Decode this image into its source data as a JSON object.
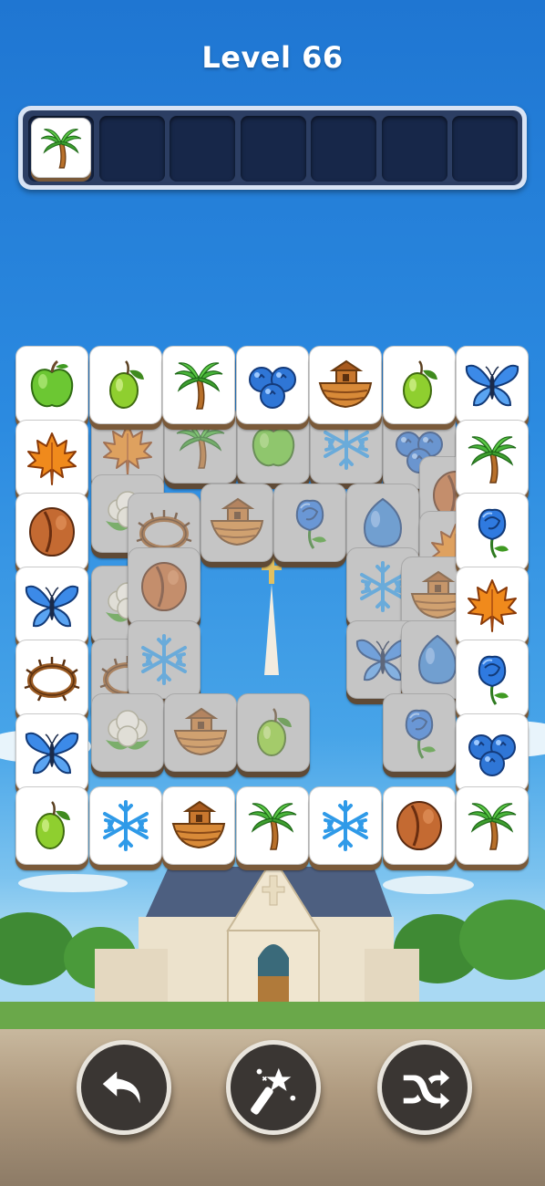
{
  "level_title": "Level 66",
  "tray": {
    "slot_count": 7,
    "filled": [
      "palm-tree"
    ]
  },
  "board": {
    "top_row": [
      "apple",
      "olive",
      "palm-tree",
      "blueberries",
      "ark",
      "olive",
      "butterfly"
    ],
    "left_column": [
      "maple-leaf",
      "coffee-bean",
      "butterfly",
      "thorn-crown",
      "butterfly"
    ],
    "right_column": [
      "palm-tree",
      "blue-rose",
      "maple-leaf",
      "blue-rose",
      "blueberries"
    ],
    "bottom_row": [
      "olive",
      "snowflake",
      "ark",
      "palm-tree",
      "snowflake",
      "coffee-bean",
      "palm-tree"
    ],
    "inner_dim": [
      "maple-leaf",
      "palm-tree",
      "apple",
      "snowflake",
      "blueberries",
      "coffee-bean",
      "cauliflower",
      "thorn-crown",
      "ark",
      "blue-rose",
      "egg",
      "maple-leaf",
      "cauliflower",
      "coffee-bean",
      "snowflake",
      "ark",
      "thorn-crown",
      "snowflake",
      "butterfly",
      "egg",
      "cauliflower",
      "ark",
      "olive",
      "blue-rose"
    ]
  },
  "actions": [
    {
      "name": "undo",
      "icon": "undo-icon"
    },
    {
      "name": "magic-wand",
      "icon": "magic-wand-icon"
    },
    {
      "name": "shuffle",
      "icon": "shuffle-icon"
    }
  ],
  "colors": {
    "sky_top": "#1f76d2",
    "tile_face": "#ffffff",
    "tile_edge": "#7a5a3a",
    "tray_border": "#d8e3f4",
    "tray_slot": "#172749",
    "button_bg": "#3a3633"
  }
}
